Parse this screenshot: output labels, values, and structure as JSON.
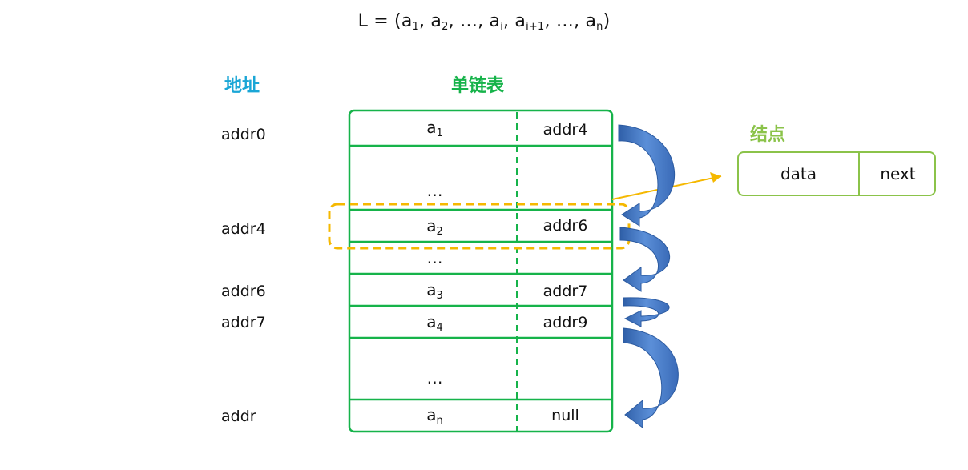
{
  "formula": {
    "prefix": "L = (a",
    "s1": "1",
    "t1": ", a",
    "s2": "2",
    "t2": ", …, a",
    "s3": "i",
    "t3": ", a",
    "s4": "i+1",
    "t4": ", …, a",
    "s5": "n",
    "t5": ")"
  },
  "headers": {
    "address": "地址",
    "list": "单链表",
    "node": "结点"
  },
  "addresses": [
    "addr0",
    "addr4",
    "addr6",
    "addr7",
    "addr"
  ],
  "rows": [
    {
      "data_base": "a",
      "data_sub": "1",
      "next": "addr4"
    },
    {
      "ellipsis": "…"
    },
    {
      "data_base": "a",
      "data_sub": "2",
      "next": "addr6"
    },
    {
      "ellipsis": "…"
    },
    {
      "data_base": "a",
      "data_sub": "3",
      "next": "addr7"
    },
    {
      "data_base": "a",
      "data_sub": "4",
      "next": "addr9"
    },
    {
      "ellipsis": "…"
    },
    {
      "data_base": "a",
      "data_sub": "n",
      "next": "null"
    }
  ],
  "node": {
    "data_label": "data",
    "next_label": "next"
  },
  "colors": {
    "list_border": "#16b34a",
    "highlight": "#f5b800",
    "arrow": "#4a7cc9",
    "node_border": "#8bc34a",
    "address_header": "#1aa6d6"
  }
}
